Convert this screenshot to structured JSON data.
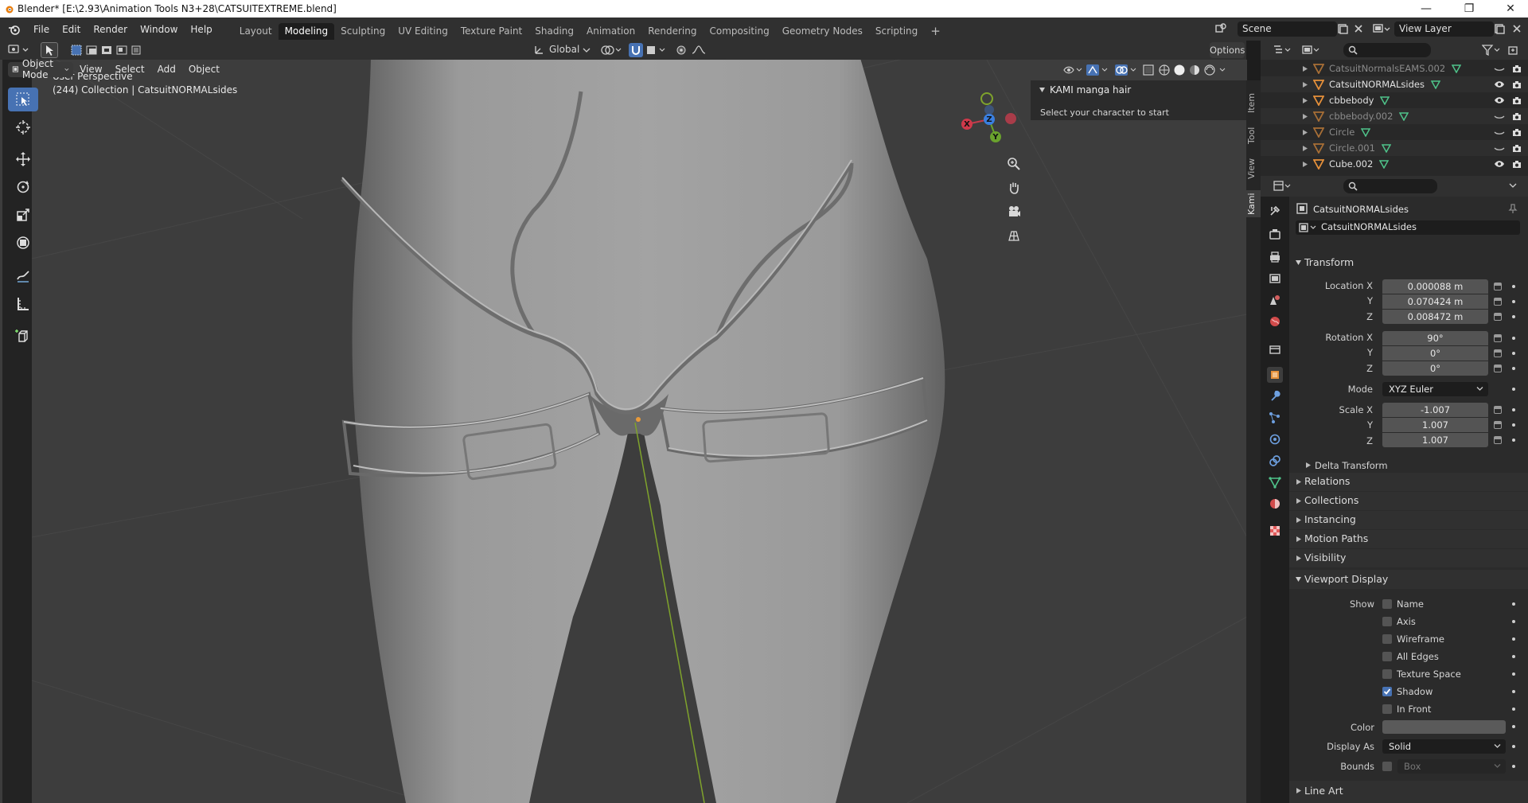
{
  "window": {
    "title": "Blender* [E:\\2.93\\Animation Tools N3+28\\CATSUITEXTREME.blend]",
    "minimize": "—",
    "maximize": "❐",
    "close": "✕"
  },
  "menus": [
    "File",
    "Edit",
    "Render",
    "Window",
    "Help"
  ],
  "workspaces": [
    "Layout",
    "Modeling",
    "Sculpting",
    "UV Editing",
    "Texture Paint",
    "Shading",
    "Animation",
    "Rendering",
    "Compositing",
    "Geometry Nodes",
    "Scripting"
  ],
  "active_workspace": "Modeling",
  "scene": "Scene",
  "view_layer": "View Layer",
  "viewport_header": {
    "mode": "Object Mode",
    "menus": [
      "View",
      "Select",
      "Add",
      "Object"
    ],
    "orientation": "Global",
    "options": "Options"
  },
  "viewport": {
    "perspective": "User Perspective",
    "collection": "(244) Collection | CatsuitNORMALsides"
  },
  "npanel": {
    "title": "KAMI manga hair",
    "text": "Select your character to start",
    "tabs": [
      "Item",
      "Tool",
      "View",
      "Kami"
    ]
  },
  "gizmo": {
    "x": "X",
    "y": "Y",
    "z": "Z"
  },
  "outliner": [
    {
      "name": "CatsuitNormalsEAMS.002",
      "dim": true
    },
    {
      "name": "CatsuitNORMALsides",
      "dim": false
    },
    {
      "name": "cbbebody",
      "dim": false
    },
    {
      "name": "cbbebody.002",
      "dim": true
    },
    {
      "name": "Circle",
      "dim": true
    },
    {
      "name": "Circle.001",
      "dim": true
    },
    {
      "name": "Cube.002",
      "dim": false
    }
  ],
  "properties": {
    "object_name": "CatsuitNORMALsides",
    "object_field": "CatsuitNORMALsides",
    "transform": {
      "title": "Transform",
      "location_label": "Location X",
      "location": [
        "0.000088 m",
        "0.070424 m",
        "0.008472 m"
      ],
      "rotation_label": "Rotation X",
      "rotation": [
        "90°",
        "0°",
        "0°"
      ],
      "mode_label": "Mode",
      "mode": "XYZ Euler",
      "scale_label": "Scale X",
      "scale": [
        "-1.007",
        "1.007",
        "1.007"
      ],
      "y": "Y",
      "z": "Z",
      "delta": "Delta Transform"
    },
    "sections": [
      "Relations",
      "Collections",
      "Instancing",
      "Motion Paths",
      "Visibility"
    ],
    "viewport_display": {
      "title": "Viewport Display",
      "show_label": "Show",
      "options": [
        {
          "label": "Name",
          "checked": false
        },
        {
          "label": "Axis",
          "checked": false
        },
        {
          "label": "Wireframe",
          "checked": false
        },
        {
          "label": "All Edges",
          "checked": false
        },
        {
          "label": "Texture Space",
          "checked": false
        },
        {
          "label": "Shadow",
          "checked": true
        },
        {
          "label": "In Front",
          "checked": false
        }
      ],
      "color_label": "Color",
      "display_as_label": "Display As",
      "display_as": "Solid",
      "bounds_label": "Bounds",
      "bounds": "Box"
    },
    "line_art": "Line Art"
  },
  "colors": {
    "accent": "#4772b3",
    "object_orange": "#e6903a",
    "mesh_green": "#4fc38a"
  }
}
